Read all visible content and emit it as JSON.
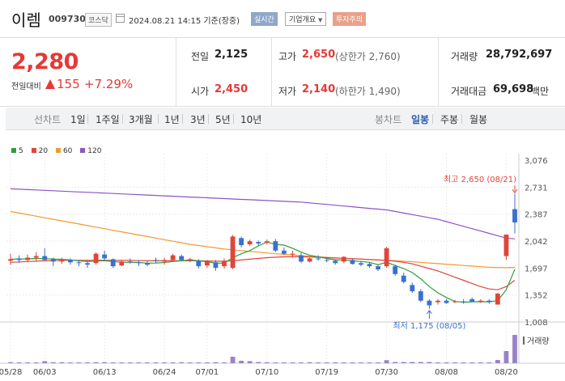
{
  "header": {
    "name": "이렘",
    "code": "009730",
    "market": "코스닥",
    "datetime": "2024.08.21 14:15 기준(장중)",
    "realtime_label": "실시간",
    "company_label": "기업개요",
    "warning_label": "투자주의"
  },
  "price": {
    "current": "2,280",
    "change_label": "전일대비",
    "change": "155",
    "change_pct": "+7.29%"
  },
  "stats": {
    "prev_label": "전일",
    "prev": "2,125",
    "open_label": "시가",
    "open": "2,450",
    "high_label": "고가",
    "high": "2,650",
    "high_sub": "(상한가 2,760)",
    "low_label": "저가",
    "low": "2,140",
    "low_sub": "(하한가 1,490)",
    "volume_label": "거래량",
    "volume": "28,792,697",
    "amount_label": "거래대금",
    "amount": "69,698",
    "amount_unit": "백만"
  },
  "tabs": {
    "line_label": "선차트",
    "periods": [
      "1일",
      "1주일",
      "3개월",
      "1년",
      "3년",
      "5년",
      "10년"
    ],
    "candle_label": "봉차트",
    "candle_periods": [
      "일봉",
      "주봉",
      "월봉"
    ],
    "active_candle": "일봉"
  },
  "chart_data": {
    "type": "candlestick",
    "legend": [
      {
        "name": "5",
        "color": "#2e9e3a"
      },
      {
        "name": "20",
        "color": "#e0453a"
      },
      {
        "name": "60",
        "color": "#f29a2e"
      },
      {
        "name": "120",
        "color": "#8a55c4"
      }
    ],
    "y_ticks": [
      3076,
      2731,
      2387,
      2042,
      1697,
      1352,
      1008
    ],
    "y_tick_labels": [
      "3,076",
      "2,731",
      "2,387",
      "2,042",
      "1,697",
      "1,352",
      "1,008"
    ],
    "ylim": [
      1008,
      3076
    ],
    "x_ticks": [
      "05/28",
      "06/03",
      "06/13",
      "06/24",
      "07/01",
      "07/10",
      "07/19",
      "07/30",
      "08/08",
      "08/20"
    ],
    "x_tick_index": [
      0,
      4,
      11,
      18,
      23,
      30,
      37,
      44,
      51,
      58
    ],
    "annotations": {
      "high": {
        "text": "최고 2,650 (08/21)",
        "value": 2650
      },
      "low": {
        "text": "최저 1,175 (08/05)",
        "value": 1175
      }
    },
    "volume_label": "거래량",
    "candles": [
      [
        1790,
        1880,
        1740,
        1810
      ],
      [
        1820,
        1860,
        1760,
        1800
      ],
      [
        1800,
        1870,
        1770,
        1830
      ],
      [
        1830,
        1900,
        1790,
        1850
      ],
      [
        1850,
        1950,
        1800,
        1800
      ],
      [
        1810,
        1830,
        1720,
        1780
      ],
      [
        1780,
        1830,
        1750,
        1800
      ],
      [
        1800,
        1820,
        1740,
        1770
      ],
      [
        1770,
        1800,
        1720,
        1760
      ],
      [
        1760,
        1790,
        1700,
        1740
      ],
      [
        1760,
        1900,
        1740,
        1880
      ],
      [
        1870,
        1920,
        1800,
        1820
      ],
      [
        1810,
        1820,
        1700,
        1720
      ],
      [
        1730,
        1800,
        1720,
        1780
      ],
      [
        1780,
        1820,
        1750,
        1770
      ],
      [
        1770,
        1800,
        1720,
        1760
      ],
      [
        1760,
        1790,
        1720,
        1740
      ],
      [
        1800,
        1830,
        1760,
        1790
      ],
      [
        1780,
        1830,
        1740,
        1800
      ],
      [
        1800,
        1880,
        1790,
        1860
      ],
      [
        1850,
        1870,
        1790,
        1800
      ],
      [
        1800,
        1830,
        1770,
        1810
      ],
      [
        1790,
        1810,
        1690,
        1720
      ],
      [
        1730,
        1800,
        1700,
        1780
      ],
      [
        1770,
        1800,
        1660,
        1700
      ],
      [
        1720,
        1820,
        1690,
        1790
      ],
      [
        1700,
        2120,
        1680,
        2100
      ],
      [
        2080,
        2100,
        1960,
        1990
      ],
      [
        2000,
        2060,
        1980,
        2040
      ],
      [
        2030,
        2050,
        1980,
        2010
      ],
      [
        2020,
        2060,
        2000,
        2040
      ],
      [
        2040,
        2070,
        1900,
        1920
      ],
      [
        1920,
        1960,
        1860,
        1880
      ],
      [
        1880,
        1920,
        1830,
        1880
      ],
      [
        1860,
        1890,
        1760,
        1780
      ],
      [
        1780,
        1830,
        1770,
        1820
      ],
      [
        1820,
        1860,
        1790,
        1810
      ],
      [
        1800,
        1830,
        1770,
        1790
      ],
      [
        1790,
        1810,
        1740,
        1760
      ],
      [
        1780,
        1850,
        1760,
        1840
      ],
      [
        1800,
        1820,
        1740,
        1750
      ],
      [
        1760,
        1790,
        1720,
        1740
      ],
      [
        1750,
        1770,
        1700,
        1720
      ],
      [
        1720,
        1740,
        1660,
        1680
      ],
      [
        1720,
        1970,
        1700,
        1950
      ],
      [
        1720,
        1740,
        1600,
        1620
      ],
      [
        1600,
        1640,
        1500,
        1520
      ],
      [
        1480,
        1510,
        1380,
        1400
      ],
      [
        1400,
        1430,
        1260,
        1280
      ],
      [
        1280,
        1300,
        1175,
        1220
      ],
      [
        1260,
        1300,
        1230,
        1280
      ],
      [
        1280,
        1300,
        1240,
        1250
      ],
      [
        1260,
        1290,
        1250,
        1270
      ],
      [
        1270,
        1300,
        1240,
        1260
      ],
      [
        1300,
        1320,
        1260,
        1270
      ],
      [
        1270,
        1300,
        1250,
        1280
      ],
      [
        1280,
        1300,
        1240,
        1260
      ],
      [
        1230,
        1380,
        1230,
        1370
      ],
      [
        1850,
        2100,
        1800,
        2125
      ],
      [
        2450,
        2650,
        2140,
        2280
      ]
    ],
    "ma5": [
      1810,
      1812,
      1815,
      1820,
      1818,
      1812,
      1808,
      1800,
      1790,
      1780,
      1788,
      1790,
      1780,
      1770,
      1770,
      1768,
      1760,
      1762,
      1768,
      1780,
      1790,
      1800,
      1790,
      1778,
      1760,
      1760,
      1830,
      1880,
      1920,
      1980,
      2030,
      2000,
      1990,
      1950,
      1900,
      1860,
      1840,
      1820,
      1800,
      1800,
      1790,
      1780,
      1770,
      1740,
      1770,
      1730,
      1690,
      1640,
      1560,
      1460,
      1380,
      1320,
      1270,
      1260,
      1265,
      1268,
      1266,
      1280,
      1420,
      1680
    ],
    "ma20": [
      1770,
      1775,
      1780,
      1785,
      1790,
      1792,
      1795,
      1796,
      1796,
      1795,
      1796,
      1797,
      1796,
      1795,
      1794,
      1792,
      1790,
      1790,
      1790,
      1790,
      1790,
      1790,
      1790,
      1788,
      1785,
      1783,
      1790,
      1800,
      1810,
      1820,
      1830,
      1835,
      1840,
      1842,
      1840,
      1838,
      1835,
      1830,
      1825,
      1822,
      1818,
      1812,
      1806,
      1800,
      1796,
      1785,
      1770,
      1750,
      1720,
      1690,
      1660,
      1620,
      1580,
      1540,
      1500,
      1460,
      1430,
      1420,
      1460,
      1540
    ],
    "ma60": [
      2420,
      2400,
      2380,
      2360,
      2340,
      2320,
      2300,
      2280,
      2260,
      2240,
      2220,
      2200,
      2180,
      2160,
      2140,
      2120,
      2100,
      2080,
      2060,
      2040,
      2020,
      2000,
      1985,
      1970,
      1955,
      1940,
      1930,
      1920,
      1910,
      1900,
      1890,
      1880,
      1872,
      1864,
      1856,
      1848,
      1840,
      1834,
      1828,
      1822,
      1816,
      1810,
      1805,
      1800,
      1795,
      1790,
      1784,
      1778,
      1770,
      1762,
      1754,
      1746,
      1738,
      1730,
      1722,
      1714,
      1708,
      1704,
      1702,
      1706
    ],
    "ma120": [
      2710,
      2705,
      2700,
      2695,
      2690,
      2685,
      2680,
      2675,
      2670,
      2665,
      2660,
      2655,
      2650,
      2645,
      2640,
      2635,
      2630,
      2625,
      2620,
      2615,
      2610,
      2605,
      2600,
      2595,
      2590,
      2585,
      2580,
      2575,
      2570,
      2565,
      2560,
      2555,
      2550,
      2545,
      2540,
      2530,
      2520,
      2510,
      2500,
      2490,
      2480,
      2470,
      2460,
      2450,
      2440,
      2420,
      2400,
      2380,
      2360,
      2340,
      2320,
      2290,
      2260,
      2230,
      2200,
      2170,
      2140,
      2110,
      2080,
      2070
    ],
    "volume": [
      0.5,
      0.4,
      0.4,
      0.4,
      1,
      0.5,
      0.5,
      0.4,
      0.4,
      0.4,
      0.5,
      0.5,
      0.4,
      0.4,
      0.4,
      0.4,
      0.4,
      0.4,
      0.4,
      0.4,
      0.5,
      0.4,
      0.4,
      0.4,
      0.5,
      0.4,
      3.2,
      1.2,
      1,
      0.6,
      0.5,
      0.4,
      0.4,
      0.4,
      0.4,
      0.5,
      0.4,
      0.4,
      0.4,
      0.4,
      0.4,
      0.4,
      0.4,
      0.4,
      1.5,
      0.6,
      0.6,
      0.6,
      0.6,
      0.6,
      0.4,
      0.4,
      0.4,
      0.4,
      0.4,
      0.4,
      0.4,
      1.6,
      6,
      14
    ]
  }
}
